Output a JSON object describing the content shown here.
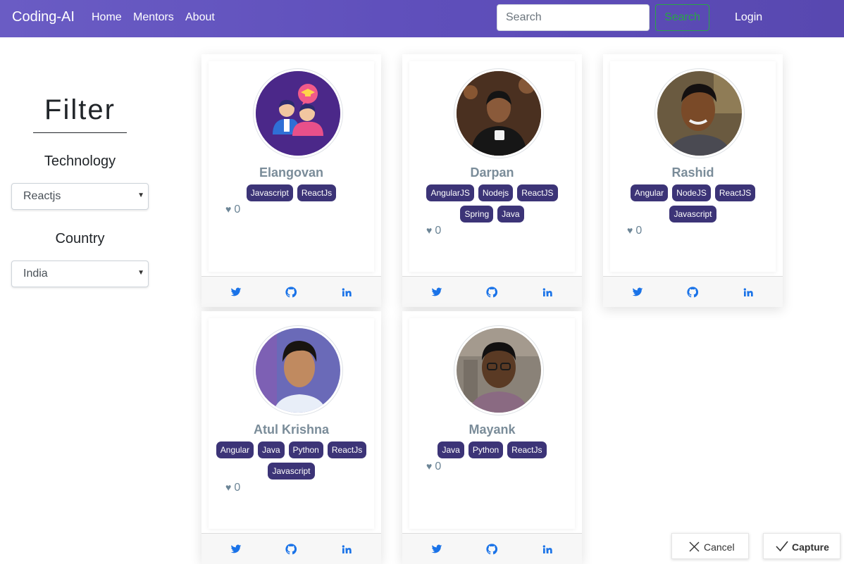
{
  "navbar": {
    "brand": "Coding-AI",
    "links": [
      "Home",
      "Mentors",
      "About"
    ],
    "search_placeholder": "Search",
    "search_button": "Search",
    "login": "Login"
  },
  "filter": {
    "title": "Filter",
    "technology_label": "Technology",
    "technology_value": "Reactjs",
    "country_label": "Country",
    "country_value": "India"
  },
  "mentors": [
    {
      "name": "Elangovan",
      "tags": [
        "Javascript",
        "ReactJs"
      ],
      "likes": "0",
      "avatar": "mentor-illustration"
    },
    {
      "name": "Darpan",
      "tags": [
        "AngularJS",
        "Nodejs",
        "ReactJS",
        "Spring",
        "Java"
      ],
      "likes": "0",
      "avatar": "photo"
    },
    {
      "name": "Rashid",
      "tags": [
        "Angular",
        "NodeJS",
        "ReactJS",
        "Javascript"
      ],
      "likes": "0",
      "avatar": "photo"
    },
    {
      "name": "Atul Krishna",
      "tags": [
        "Angular",
        "Java",
        "Python",
        "ReactJs",
        "Javascript"
      ],
      "likes": "0",
      "avatar": "photo"
    },
    {
      "name": "Mayank",
      "tags": [
        "Java",
        "Python",
        "ReactJs"
      ],
      "likes": "0",
      "avatar": "photo"
    }
  ],
  "social_icons": [
    "twitter-icon",
    "github-icon",
    "linkedin-icon"
  ],
  "bottom_bar": {
    "cancel": "Cancel",
    "capture": "Capture"
  },
  "colors": {
    "navbar": "#6a5cc4",
    "tag": "#3c3477",
    "search_button": "#28a745",
    "social": "#1a73e8"
  }
}
